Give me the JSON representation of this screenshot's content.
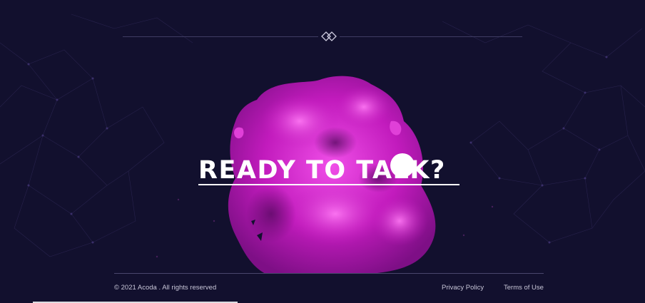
{
  "cta": {
    "headline": "READY TO TALK?"
  },
  "footer": {
    "copyright": "© 2021 Acoda . All rights reserved",
    "links": [
      {
        "label": "Privacy Policy"
      },
      {
        "label": "Terms of Use"
      }
    ]
  },
  "colors": {
    "background": "#12102e",
    "accent": "#d21fc8",
    "text": "#ffffff"
  },
  "icons": [
    "diamond-logo-icon"
  ]
}
